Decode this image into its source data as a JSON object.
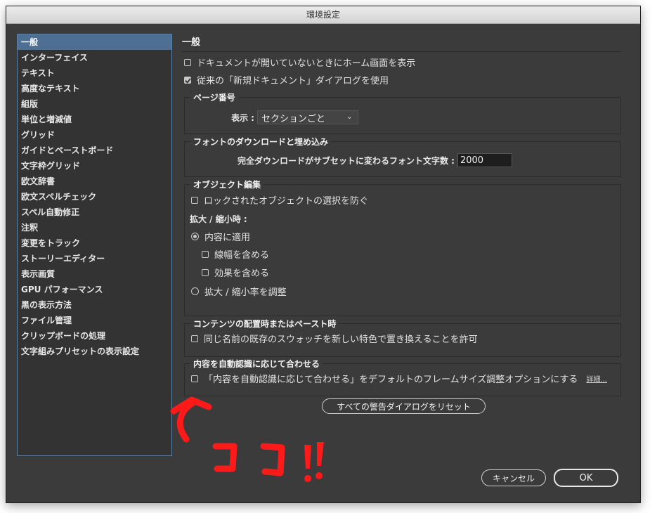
{
  "window": {
    "title": "環境設定"
  },
  "sidebar": {
    "items": [
      {
        "label": "一般",
        "selected": true
      },
      {
        "label": "インターフェイス"
      },
      {
        "label": "テキスト"
      },
      {
        "label": "高度なテキスト"
      },
      {
        "label": "組版"
      },
      {
        "label": "単位と増減値"
      },
      {
        "label": "グリッド"
      },
      {
        "label": "ガイドとペーストボード"
      },
      {
        "label": "文字枠グリッド"
      },
      {
        "label": "欧文辞書"
      },
      {
        "label": "欧文スペルチェック"
      },
      {
        "label": "スペル自動修正"
      },
      {
        "label": "注釈"
      },
      {
        "label": "変更をトラック"
      },
      {
        "label": "ストーリーエディター"
      },
      {
        "label": "表示画質"
      },
      {
        "label": "GPU パフォーマンス"
      },
      {
        "label": "黒の表示方法"
      },
      {
        "label": "ファイル管理"
      },
      {
        "label": "クリップボードの処理"
      },
      {
        "label": "文字組みプリセットの表示設定"
      }
    ]
  },
  "general": {
    "heading": "一般",
    "show_home_label": "ドキュメントが開いていないときにホーム画面を表示",
    "show_home_checked": false,
    "legacy_new_doc_label": "従来の「新規ドキュメント」ダイアログを使用",
    "legacy_new_doc_checked": true
  },
  "page_numbering": {
    "title": "ページ番号",
    "view_label": "表示 :",
    "view_value": "セクションごと"
  },
  "font_download": {
    "title": "フォントのダウンロードと埋め込み",
    "threshold_label": "完全ダウンロードがサブセットに変わるフォント文字数 :",
    "threshold_value": "2000"
  },
  "object_editing": {
    "title": "オブジェクト編集",
    "prevent_locked_label": "ロックされたオブジェクトの選択を防ぐ",
    "scaling_label": "拡大 / 縮小時 :",
    "apply_to_content_label": "内容に適用",
    "include_stroke_label": "線幅を含める",
    "include_effects_label": "効果を含める",
    "adjust_scale_label": "拡大 / 縮小率を調整"
  },
  "paste_content": {
    "title": "コンテンツの配置時またはペースト時",
    "replace_swatch_label": "同じ名前の既存のスウォッチを新しい特色で置き換えることを許可"
  },
  "content_aware": {
    "title": "内容を自動認識に応じて合わせる",
    "default_label": "「内容を自動認識に応じて合わせる」をデフォルトのフレームサイズ調整オプションにする",
    "detail_link": "詳細..."
  },
  "buttons": {
    "reset_warnings": "すべての警告ダイアログをリセット",
    "cancel": "キャンセル",
    "ok": "OK"
  },
  "annotation": {
    "text": "ココ!!",
    "color": "#ff1a1a"
  },
  "colors": {
    "selection": "#4d6f93",
    "panel": "#3b3b3b",
    "sidebar_border": "#5d7fa1"
  }
}
